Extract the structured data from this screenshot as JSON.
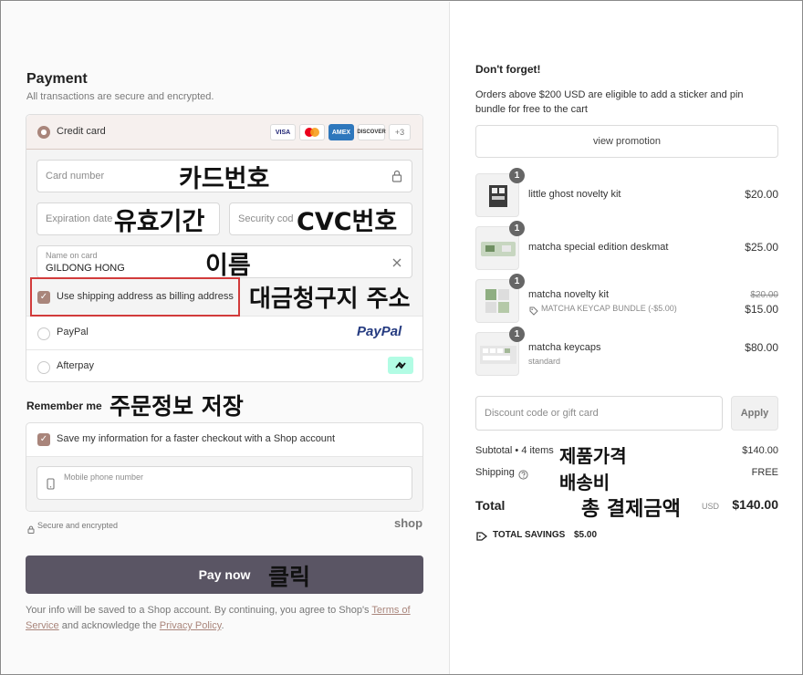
{
  "payment": {
    "title": "Payment",
    "subtitle": "All transactions are secure and encrypted.",
    "credit_card_label": "Credit card",
    "card_brands": [
      "VISA",
      "",
      "AMEX",
      "DISCOVER"
    ],
    "more_brands": "+3",
    "card_number_placeholder": "Card number",
    "expiration_placeholder": "Expiration date",
    "security_placeholder": "Security cod",
    "name_label": "Name on card",
    "name_value": "GILDONG HONG",
    "billing_checkbox_label": "Use shipping address as billing address",
    "paypal_label": "PayPal",
    "paypal_logo": "PayPal",
    "afterpay_label": "Afterpay"
  },
  "remember": {
    "title": "Remember me",
    "save_label": "Save my information for a faster checkout with a Shop account",
    "phone_placeholder": "Mobile phone number",
    "secure_note": "Secure and encrypted",
    "shop_logo": "shop"
  },
  "pay_button": "Pay now",
  "legal": {
    "text1": "Your info will be saved to a Shop account. By continuing, you agree to Shop's ",
    "terms": "Terms of Service",
    "text2": " and acknowledge the ",
    "privacy": "Privacy Policy",
    "text3": "."
  },
  "annotations": {
    "card_number": "카드번호",
    "expiration": "유효기간",
    "cvc": "CVC번호",
    "name": "이름",
    "billing": "대금청구지 주소",
    "remember": "주문정보 저장",
    "click": "클릭",
    "subtotal": "제품가격",
    "shipping": "배송비",
    "total": "총 결제금액"
  },
  "promo": {
    "title": "Don't forget!",
    "text": "Orders above $200 USD are eligible to add a sticker and pin bundle for free to the cart",
    "button": "view promotion"
  },
  "items": [
    {
      "qty": "1",
      "name": "little ghost novelty kit",
      "price": "$20.00",
      "sub": "",
      "old_price": ""
    },
    {
      "qty": "1",
      "name": "matcha special edition deskmat",
      "price": "$25.00",
      "sub": "",
      "old_price": ""
    },
    {
      "qty": "1",
      "name": "matcha novelty kit",
      "price": "$15.00",
      "sub": "MATCHA KEYCAP BUNDLE (-$5.00)",
      "old_price": "$20.00"
    },
    {
      "qty": "1",
      "name": "matcha keycaps",
      "price": "$80.00",
      "sub": "standard",
      "old_price": ""
    }
  ],
  "discount": {
    "placeholder": "Discount code or gift card",
    "apply": "Apply"
  },
  "summary": {
    "subtotal_label": "Subtotal • 4 items",
    "subtotal_value": "$140.00",
    "shipping_label": "Shipping",
    "shipping_value": "FREE",
    "total_label": "Total",
    "currency": "USD",
    "total_value": "$140.00",
    "savings_label": "TOTAL SAVINGS",
    "savings_value": "$5.00"
  },
  "colors": {
    "accent": "#a9857b",
    "button": "#5a5564",
    "annotation_box": "#d23b3b"
  }
}
